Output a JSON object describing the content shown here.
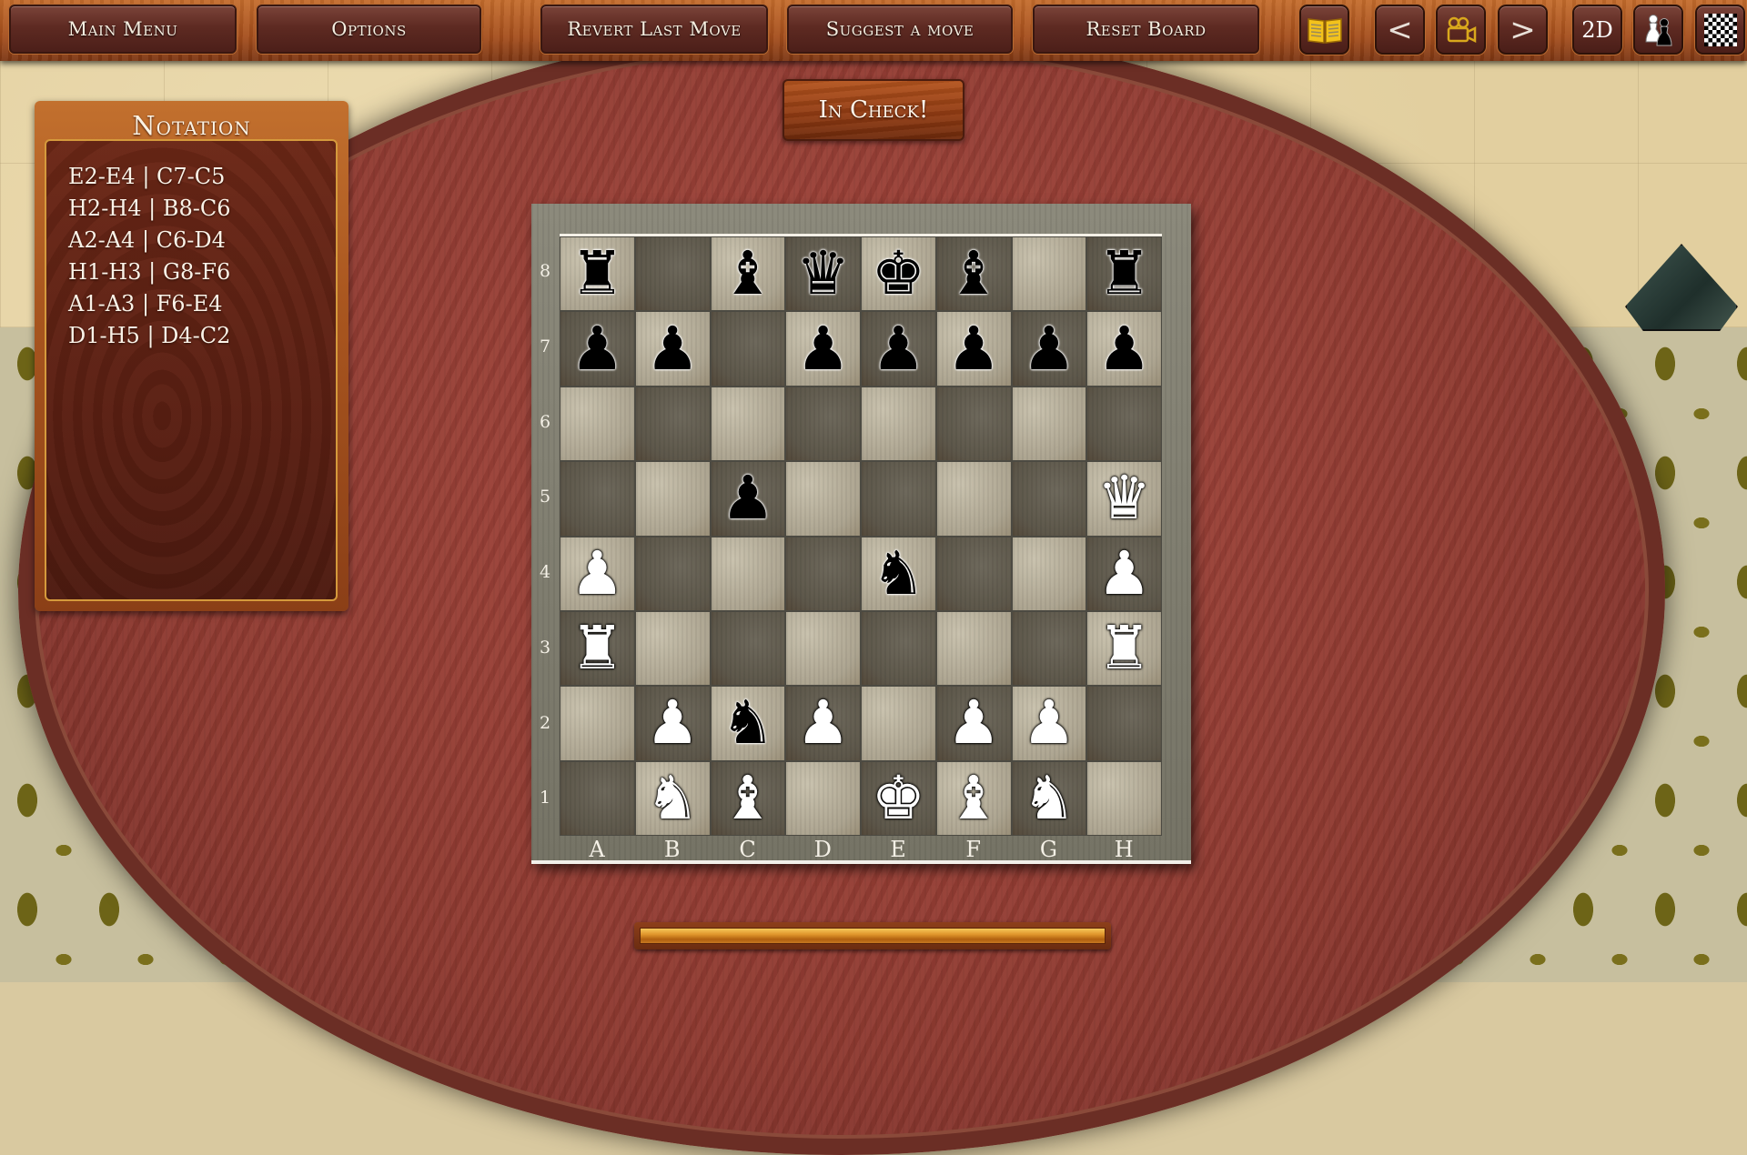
{
  "toolbar": {
    "main_menu": "Main Menu",
    "options": "Options",
    "revert_last_move": "Revert Last Move",
    "suggest_move": "Suggest a move",
    "reset_board": "Reset Board",
    "icons": {
      "book": "open-book-icon",
      "prev": "<",
      "camera": "camera-icon",
      "next": ">",
      "view_2d": "2D",
      "players": "pawns-icon",
      "board_style": "checkerboard-icon"
    }
  },
  "notation": {
    "title": "Notation",
    "moves": [
      "E2-E4 | C7-C5",
      "H2-H4 | B8-C6",
      "A2-A4 | C6-D4",
      "H1-H3 | G8-F6",
      "A1-A3 | F6-E4",
      "D1-H5 | D4-C2"
    ]
  },
  "status": {
    "message": "In Check!"
  },
  "board": {
    "ranks": [
      "8",
      "7",
      "6",
      "5",
      "4",
      "3",
      "2",
      "1"
    ],
    "files": [
      "A",
      "B",
      "C",
      "D",
      "E",
      "F",
      "G",
      "H"
    ],
    "rows": [
      [
        "br",
        "",
        "bb",
        "bq",
        "bk",
        "bb",
        "",
        "br"
      ],
      [
        "bp",
        "bp",
        "",
        "bp",
        "bp",
        "bp",
        "bp",
        "bp"
      ],
      [
        "",
        "",
        "",
        "",
        "",
        "",
        "",
        ""
      ],
      [
        "",
        "",
        "bp",
        "",
        "",
        "",
        "",
        "wq"
      ],
      [
        "wp",
        "",
        "",
        "",
        "bn",
        "",
        "",
        "wp"
      ],
      [
        "wr",
        "",
        "",
        "",
        "",
        "",
        "",
        "wr"
      ],
      [
        "",
        "wp",
        "bn",
        "wp",
        "",
        "wp",
        "wp",
        ""
      ],
      [
        "",
        "wn",
        "wb",
        "",
        "wk",
        "wb",
        "wn",
        ""
      ]
    ]
  },
  "progress": {
    "fraction": 1.0
  },
  "colors": {
    "accent_gold": "#e0962c",
    "button_bg": "#5e2a22",
    "table_wood": "#9a4338"
  }
}
